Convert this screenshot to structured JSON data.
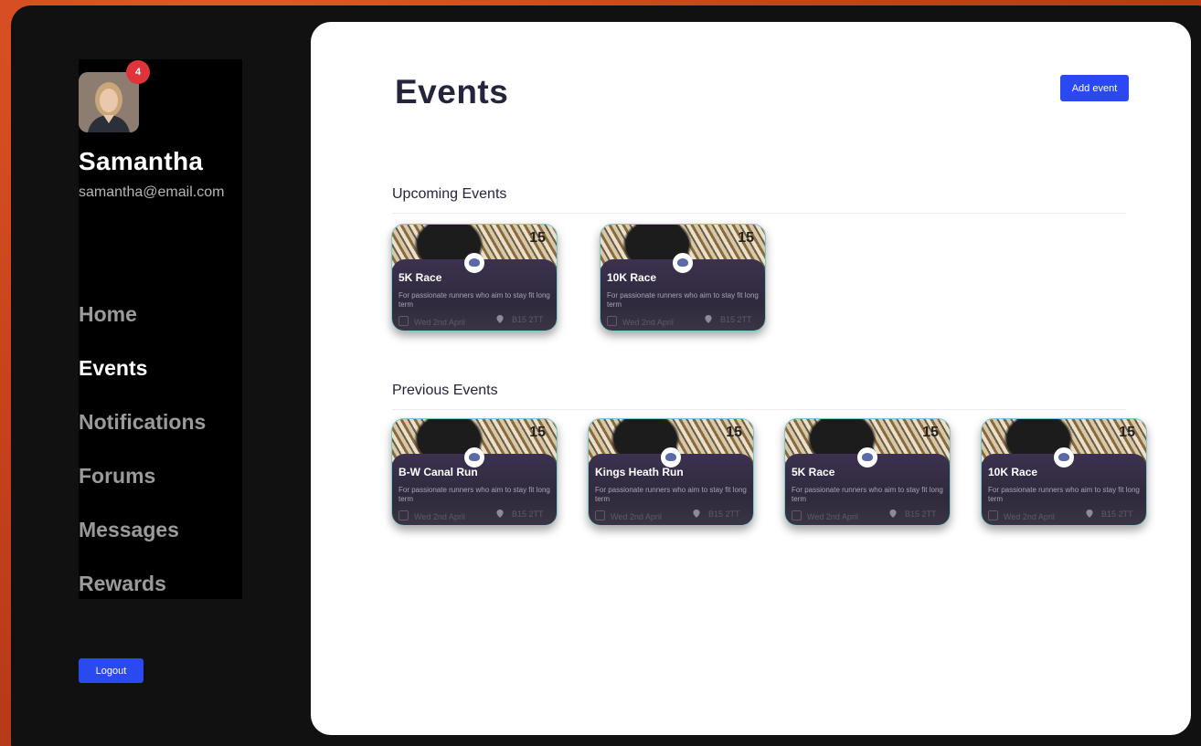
{
  "user": {
    "name": "Samantha",
    "email": "samantha@email.com",
    "notification_count": "4"
  },
  "nav": {
    "items": [
      {
        "label": "Home",
        "active": false
      },
      {
        "label": "Events",
        "active": true
      },
      {
        "label": "Notifications",
        "active": false
      },
      {
        "label": "Forums",
        "active": false
      },
      {
        "label": "Messages",
        "active": false
      },
      {
        "label": "Rewards",
        "active": false
      }
    ],
    "logout_label": "Logout"
  },
  "page": {
    "title": "Events",
    "add_button_label": "Add event"
  },
  "upcoming": {
    "heading": "Upcoming Events",
    "events": [
      {
        "day": "15",
        "title": "5K Race",
        "description": "For passionate runners who aim to stay fit long term",
        "date": "Wed 2nd April",
        "location": "B15 2TT"
      },
      {
        "day": "15",
        "title": "10K Race",
        "description": "For passionate runners who aim to stay fit long term",
        "date": "Wed 2nd April",
        "location": "B15 2TT"
      }
    ]
  },
  "previous": {
    "heading": "Previous Events",
    "events": [
      {
        "day": "15",
        "title": "B-W Canal Run",
        "description": "For passionate runners who aim to stay fit long term",
        "date": "Wed 2nd April",
        "location": "B15 2TT"
      },
      {
        "day": "15",
        "title": "Kings Heath Run",
        "description": "For passionate runners who aim to stay fit long term",
        "date": "Wed 2nd April",
        "location": "B15 2TT"
      },
      {
        "day": "15",
        "title": "5K Race",
        "description": "For passionate runners who aim to stay fit long term",
        "date": "Wed 2nd April",
        "location": "B15 2TT"
      },
      {
        "day": "15",
        "title": "10K Race",
        "description": "For passionate runners who aim to stay fit long term",
        "date": "Wed 2nd April",
        "location": "B15 2TT"
      }
    ]
  },
  "colors": {
    "accent": "#2a49f0",
    "badge": "#e0343a",
    "sidebar_bg": "#000000",
    "frame_bg": "#111111"
  },
  "icons": [
    "calendar-icon",
    "location-pin-icon",
    "club-logo-icon"
  ]
}
